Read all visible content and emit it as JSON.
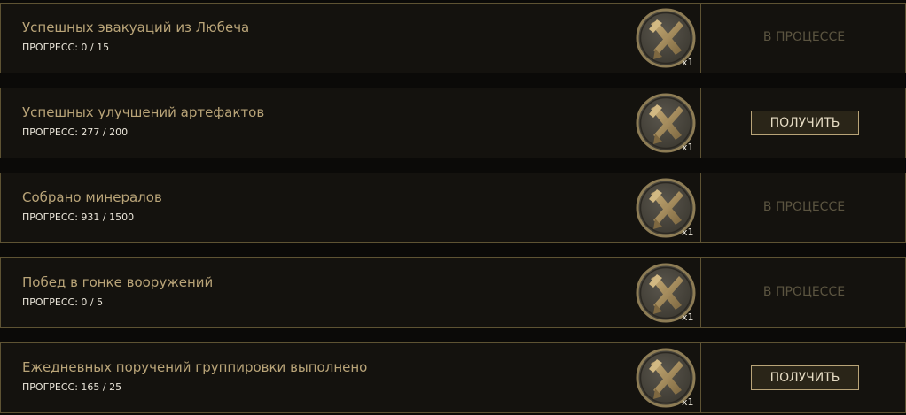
{
  "tasks": [
    {
      "title": "Успешных эвакуаций из Любеча",
      "progress": "ПРОГРЕСС: 0 / 15",
      "reward_qty": "x1",
      "reward_icon": "crossed-tools-coin-icon",
      "status": "В ПРОЦЕССЕ",
      "claim_label": ""
    },
    {
      "title": "Успешных улучшений артефактов",
      "progress": "ПРОГРЕСС: 277 / 200",
      "reward_qty": "x1",
      "reward_icon": "crossed-tools-coin-icon",
      "status": "",
      "claim_label": "ПОЛУЧИТЬ"
    },
    {
      "title": "Собрано минералов",
      "progress": "ПРОГРЕСС: 931 / 1500",
      "reward_qty": "x1",
      "reward_icon": "crossed-tools-coin-icon",
      "status": "В ПРОЦЕССЕ",
      "claim_label": ""
    },
    {
      "title": "Побед в гонке вооружений",
      "progress": "ПРОГРЕСС: 0 / 5",
      "reward_qty": "x1",
      "reward_icon": "crossed-tools-coin-icon",
      "status": "В ПРОЦЕССЕ",
      "claim_label": ""
    },
    {
      "title": "Ежедневных поручений группировки выполнено",
      "progress": "ПРОГРЕСС: 165 / 25",
      "reward_qty": "x1",
      "reward_icon": "crossed-tools-coin-icon",
      "status": "",
      "claim_label": "ПОЛУЧИТЬ"
    }
  ],
  "colors": {
    "title": "#b9a478",
    "border": "#5e5333",
    "status_inactive": "#5b5440",
    "button_border": "#b9a478",
    "coin": "#4a463f",
    "coin_rim": "#8d7c55",
    "emblem": "#a58a5a"
  }
}
